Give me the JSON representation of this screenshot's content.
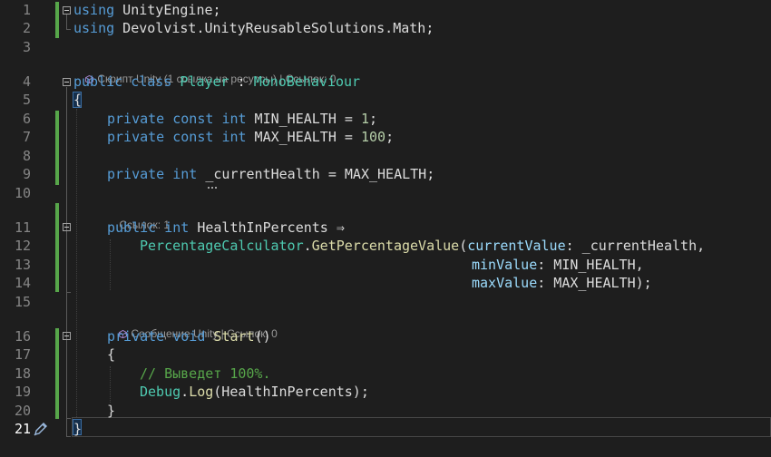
{
  "editor": {
    "language": "C#",
    "accent_colors": {
      "keyword": "#569cd6",
      "type": "#4ec9b0",
      "method": "#dcdcaa",
      "number": "#b5cea8",
      "comment": "#57a64a",
      "parameter": "#9cdcfe",
      "change_bar": "#57a64a",
      "line_number": "#858585",
      "background": "#1e1e1e"
    },
    "current_line": 21
  },
  "line_numbers": [
    "1",
    "2",
    "3",
    "4",
    "5",
    "6",
    "7",
    "8",
    "9",
    "10",
    "11",
    "12",
    "13",
    "14",
    "15",
    "16",
    "17",
    "18",
    "19",
    "20",
    "21"
  ],
  "code": {
    "l1": {
      "kw": "using",
      "rest": " UnityEngine;"
    },
    "l2": {
      "kw": "using",
      "rest": " Devolvist.UnityReusableSolutions.Math;"
    },
    "l4": {
      "kw1": "public",
      "kw2": "class",
      "type": "Player",
      "colon": " : ",
      "base": "MonoBehaviour"
    },
    "l5": {
      "text": "{"
    },
    "l6": {
      "kw1": "private",
      "kw2": "const",
      "kw3": "int",
      "name": " MIN_HEALTH = ",
      "num": "1",
      "end": ";"
    },
    "l7": {
      "kw1": "private",
      "kw2": "const",
      "kw3": "int",
      "name": " MAX_HEALTH = ",
      "num": "100",
      "end": ";"
    },
    "l9": {
      "kw1": "private",
      "kw2": "int",
      "rest": " _currentHealth = MAX_HEALTH;"
    },
    "l11": {
      "kw1": "public",
      "kw2": "int",
      "rest": " HealthInPercents ⇒"
    },
    "l12": {
      "type": "PercentageCalculator",
      "dot": ".",
      "method": "GetPercentageValue",
      "open": "(",
      "param": "currentValue",
      "rest": ": _currentHealth,"
    },
    "l13": {
      "param": "minValue",
      "rest": ": MIN_HEALTH,"
    },
    "l14": {
      "param": "maxValue",
      "rest": ": MAX_HEALTH);"
    },
    "l16": {
      "kw1": "private",
      "kw2": "void",
      "method": "Start",
      "rest": "()"
    },
    "l17": {
      "text": "{"
    },
    "l18": {
      "comment": "// Выведет 100%."
    },
    "l19": {
      "type": "Debug",
      "dot": ".",
      "method": "Log",
      "rest": "(HealthInPercents);"
    },
    "l20": {
      "text": "}"
    },
    "l21": {
      "text": "}"
    }
  },
  "codelens": {
    "class_lens": {
      "label": "Скрипт Unity (1 ссылка на ресурсы)",
      "sep": " | ",
      "refs": "Ссылок: 0"
    },
    "property_lens": {
      "refs": "Ссылок: 1"
    },
    "method_lens": {
      "label": "Сообщение Unity",
      "sep": " | ",
      "refs": "Ссылок: 0"
    }
  },
  "icons": {
    "unity_cube": "unity-cube-icon",
    "fold": "collapse-minus-icon",
    "pencil": "edit-pencil-icon"
  }
}
